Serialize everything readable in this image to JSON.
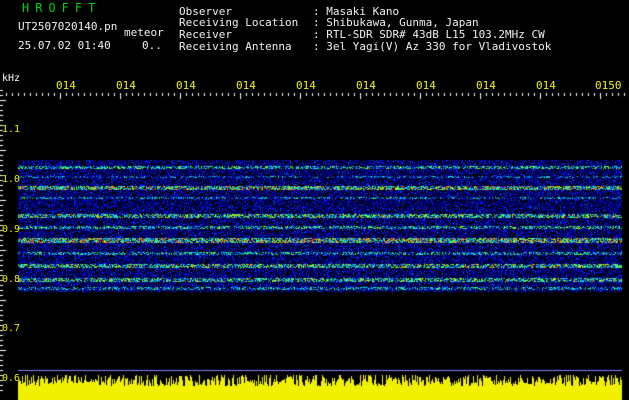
{
  "header": {
    "title": "HROFFT",
    "file": "UT2507020140.pn",
    "meteor_label": "meteor",
    "date_time": "25.07.02 01:40",
    "zero_marker": "0.."
  },
  "station_info": [
    {
      "label": "Observer",
      "value": ": Masaki Kano"
    },
    {
      "label": "Receiving Location",
      "value": ": Shibukawa, Gunma, Japan"
    },
    {
      "label": "Receiver",
      "value": ": RTL-SDR SDR# 43dB L15 103.2MHz CW"
    },
    {
      "label": "Receiving Antenna",
      "value": ": 3el Yagi(V) Az 330 for Vladivostok"
    }
  ],
  "time_axis": {
    "tick_labels": [
      "014",
      "014",
      "014",
      "014",
      "014",
      "014",
      "014",
      "014",
      "014",
      "0150"
    ]
  },
  "freq_axis": {
    "unit": "kHz",
    "labels": [
      "1.1",
      "1.0",
      "0.9",
      "0.8",
      "0.7",
      "0.6"
    ]
  },
  "colors": {
    "background": "#000000",
    "title": "#00d000",
    "axis_text": "#f0f000",
    "noise_bar": "#f0f000"
  }
}
